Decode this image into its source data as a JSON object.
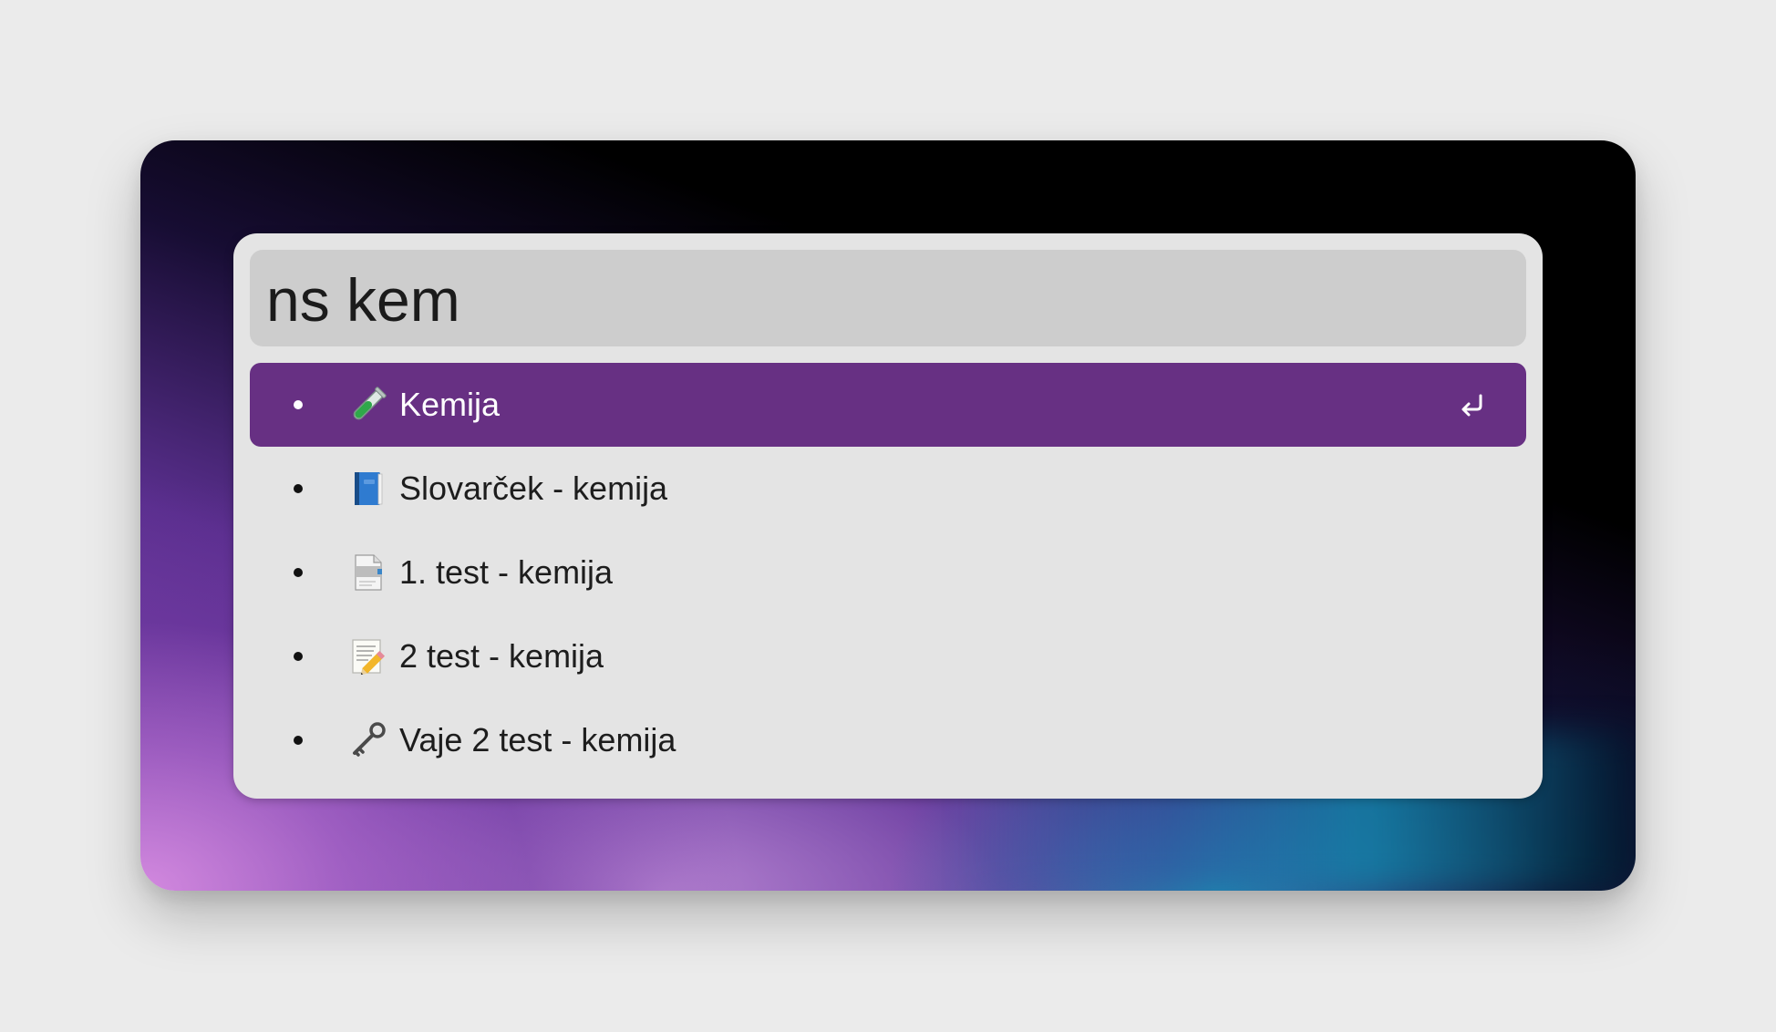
{
  "search": {
    "query": "ns kem"
  },
  "results": [
    {
      "label": "Kemija",
      "icon": "test-tube-icon",
      "selected": true
    },
    {
      "label": "Slovarček - kemija",
      "icon": "blue-book-icon",
      "selected": false
    },
    {
      "label": "1. test - kemija",
      "icon": "document-icon",
      "selected": false
    },
    {
      "label": "2 test - kemija",
      "icon": "memo-pencil-icon",
      "selected": false
    },
    {
      "label": "Vaje 2 test - kemija",
      "icon": "old-key-icon",
      "selected": false
    }
  ],
  "enter_hint_icon": "return-key-icon",
  "colors": {
    "selected_row": "#673083",
    "panel": "#e4e4e4",
    "search_field": "#cdcdcd",
    "page_background": "#ebebeb"
  }
}
